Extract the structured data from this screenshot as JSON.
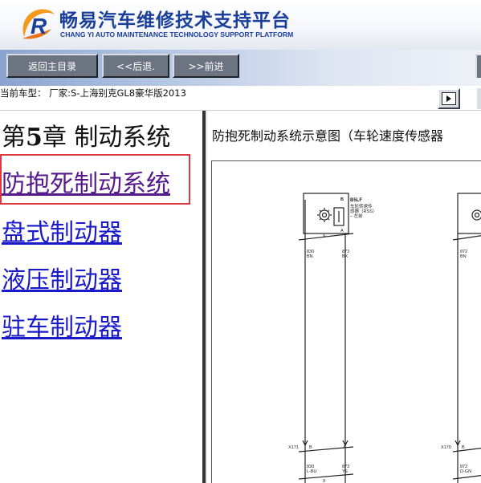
{
  "header": {
    "brand_cn": "畅易汽车维修技术支持平台",
    "brand_en": "CHANG YI AUTO MAINTENANCE TECHNOLOGY SUPPORT PLATFORM",
    "logo_letter": "R"
  },
  "toolbar": {
    "home_label": "返回主目录",
    "back_label": "<<后退.",
    "forward_label": ">>前进"
  },
  "current_vehicle": "当前车型：  厂家:S-上海别克GL8豪华版2013",
  "left_panel": {
    "chapter_prefix": "第",
    "chapter_number": "5",
    "chapter_suffix": "章 制动系统",
    "items": [
      {
        "label": "防抱死制动系统",
        "selected": true
      },
      {
        "label": "盘式制动器"
      },
      {
        "label": "液压制动器"
      },
      {
        "label": "驻车制动器"
      }
    ]
  },
  "right_panel": {
    "title": "防抱死制动系统示意图（车轮速度传感器",
    "diagram": {
      "sensor_id": "B5LF",
      "sensor_label_line1": "车轮转速传",
      "sensor_label_line2": "感器（RSS）",
      "sensor_label_line3": "– 左前",
      "pin_b": "B",
      "pin_a": "A",
      "connector_9": "9",
      "left_wire1_id": "830",
      "left_wire1_color": "BN",
      "left_wire2_id": "873",
      "left_wire2_color": "BK",
      "right_wire1_id": "872",
      "right_wire1_color": "BN",
      "x_left": "X171",
      "x_right": "X170",
      "left_lower_wire1_id": "830",
      "left_lower_wire1_color": "L-BU",
      "left_lower_wire2_id": "873",
      "left_lower_wire2_color": "YE",
      "right_lower_wire1_id": "872",
      "right_lower_wire1_color": "D-GN"
    }
  },
  "colors": {
    "brand_blue": "#1a3f9a",
    "link_blue": "#1a1ac8",
    "visited_purple": "#551a8b",
    "selection_red": "#d9393f",
    "button_gray": "#6b7480"
  }
}
